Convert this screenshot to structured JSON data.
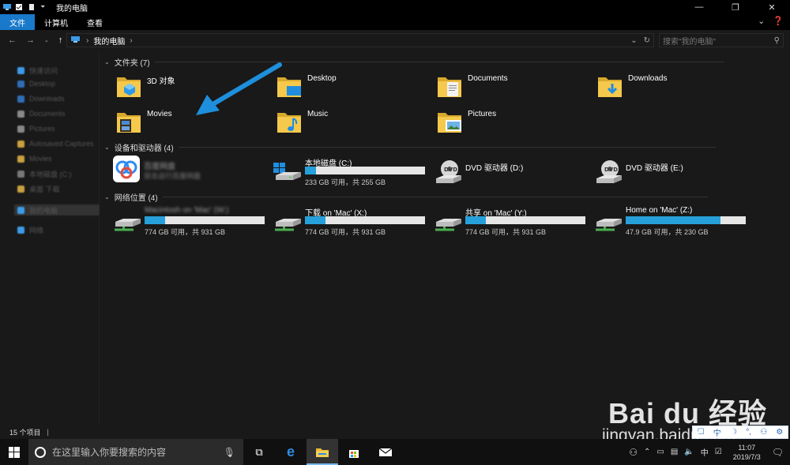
{
  "window": {
    "title": "我的电脑"
  },
  "ribbon": {
    "tabs": [
      "文件",
      "计算机",
      "查看"
    ]
  },
  "address": {
    "path": "我的电脑",
    "search_placeholder": "搜索\"我的电脑\""
  },
  "sidebar": {
    "items": [
      "快速访问",
      "Desktop",
      "Downloads",
      "Documents",
      "Pictures",
      "Autosaved Captures",
      "Movies",
      "本地磁盘 (C:)",
      "桌面 下载",
      "我的电脑",
      "网络"
    ]
  },
  "groups": {
    "folders": {
      "title": "文件夹 (7)"
    },
    "devices": {
      "title": "设备和驱动器 (4)"
    },
    "network": {
      "title": "网络位置 (4)"
    }
  },
  "folders": [
    {
      "name": "3D 对象",
      "icon": "3d-objects-folder-icon"
    },
    {
      "name": "Desktop",
      "icon": "desktop-folder-icon"
    },
    {
      "name": "Documents",
      "icon": "documents-folder-icon"
    },
    {
      "name": "Downloads",
      "icon": "downloads-folder-icon"
    },
    {
      "name": "Movies",
      "icon": "movies-folder-icon"
    },
    {
      "name": "Music",
      "icon": "music-folder-icon"
    },
    {
      "name": "Pictures",
      "icon": "pictures-folder-icon"
    }
  ],
  "devices": [
    {
      "name": "百度网盘",
      "sub": "双击运行百度网盘",
      "icon": "baidu-netdisk-icon"
    },
    {
      "name": "本地磁盘 (C:)",
      "sub": "233 GB 可用，共 255 GB",
      "used_fraction": 0.09,
      "icon": "local-disk-icon"
    },
    {
      "name": "DVD 驱动器 (D:)",
      "icon": "dvd-drive-icon"
    },
    {
      "name": "DVD 驱动器 (E:)",
      "icon": "dvd-drive-icon"
    }
  ],
  "network": [
    {
      "name": "Macintosh on 'Mac' (W:)",
      "sub": "774 GB 可用，共 931 GB",
      "used_fraction": 0.17
    },
    {
      "name": "下载 on 'Mac' (X:)",
      "sub": "774 GB 可用，共 931 GB",
      "used_fraction": 0.17
    },
    {
      "name": "共享 on 'Mac' (Y:)",
      "sub": "774 GB 可用，共 931 GB",
      "used_fraction": 0.17
    },
    {
      "name": "Home on 'Mac' (Z:)",
      "sub": "47.9 GB 可用，共 230 GB",
      "used_fraction": 0.79
    }
  ],
  "status": {
    "count": "15 个项目"
  },
  "taskbar": {
    "search_placeholder": "在这里输入你要搜索的内容",
    "time": "11:07",
    "date": "2019/7/3",
    "ime": "中"
  },
  "ime_bar": {
    "lang": "中"
  },
  "watermark": {
    "brand": "Bai du 经验",
    "url": "jingyan.baidu.com"
  },
  "colors": {
    "accent": "#1979ca",
    "bar_fill": "#26a0da",
    "background": "#191919"
  }
}
